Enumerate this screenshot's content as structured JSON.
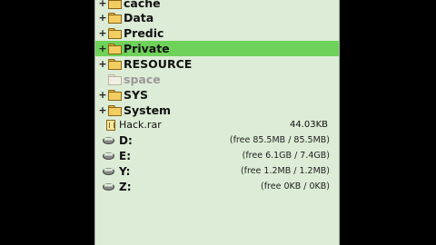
{
  "folders": [
    {
      "label": "cache",
      "expander": "+",
      "selected": false,
      "dim": false
    },
    {
      "label": "Data",
      "expander": "+",
      "selected": false,
      "dim": false
    },
    {
      "label": "Predic",
      "expander": "+",
      "selected": false,
      "dim": false
    },
    {
      "label": "Private",
      "expander": "+",
      "selected": true,
      "dim": false
    },
    {
      "label": "RESOURCE",
      "expander": "+",
      "selected": false,
      "dim": false
    },
    {
      "label": "space",
      "expander": "",
      "selected": false,
      "dim": true
    },
    {
      "label": "SYS",
      "expander": "+",
      "selected": false,
      "dim": false
    },
    {
      "label": "System",
      "expander": "+",
      "selected": false,
      "dim": false
    }
  ],
  "file": {
    "name": "Hack.rar",
    "size": "44.03KB"
  },
  "drives": [
    {
      "label": "D:",
      "info": "(free 85.5MB / 85.5MB)"
    },
    {
      "label": "E:",
      "info": "(free 6.1GB / 7.4GB)"
    },
    {
      "label": "Y:",
      "info": "(free 1.2MB / 1.2MB)"
    },
    {
      "label": "Z:",
      "info": "(free 0KB / 0KB)"
    }
  ],
  "colors": {
    "panel_bg": "#dcecd6",
    "selected_bg": "#6fd25a",
    "folder_yellow": "#f4cd62"
  }
}
